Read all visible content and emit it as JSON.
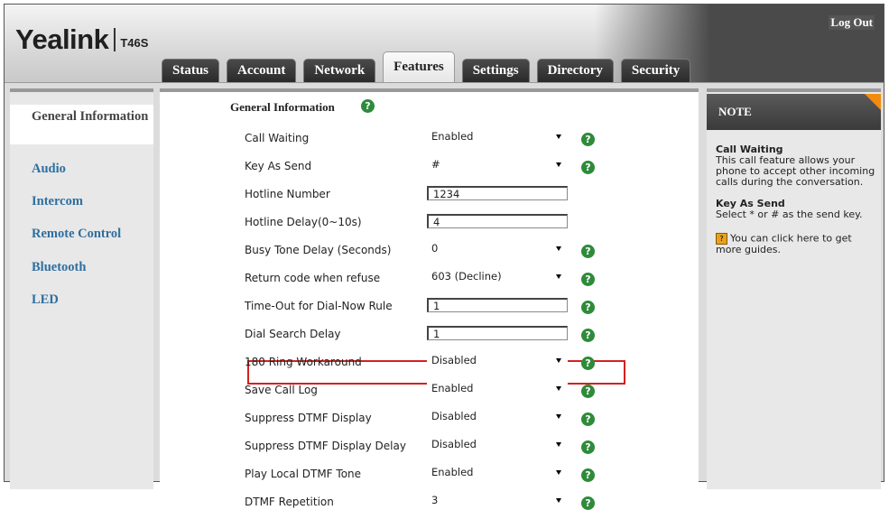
{
  "header": {
    "logo": "Yealink",
    "model": "T46S",
    "logout_label": "Log Out"
  },
  "tabs": [
    {
      "label": "Status"
    },
    {
      "label": "Account"
    },
    {
      "label": "Network"
    },
    {
      "label": "Features",
      "active": true
    },
    {
      "label": "Settings"
    },
    {
      "label": "Directory"
    },
    {
      "label": "Security"
    }
  ],
  "sidebar": {
    "items": [
      {
        "label": "General Information",
        "active": true
      },
      {
        "label": "Audio"
      },
      {
        "label": "Intercom"
      },
      {
        "label": "Remote Control"
      },
      {
        "label": "Bluetooth"
      },
      {
        "label": "LED"
      }
    ]
  },
  "main": {
    "section_title": "General Information",
    "rows": [
      {
        "label": "Call Waiting",
        "type": "select",
        "value": "Enabled",
        "help": true
      },
      {
        "label": "Key As Send",
        "type": "select",
        "value": "#",
        "help": true
      },
      {
        "label": "Hotline Number",
        "type": "text",
        "value": "1234",
        "help": false
      },
      {
        "label": "Hotline Delay(0~10s)",
        "type": "text",
        "value": "4",
        "help": false
      },
      {
        "label": "Busy Tone Delay (Seconds)",
        "type": "select",
        "value": "0",
        "help": true
      },
      {
        "label": "Return code when refuse",
        "type": "select",
        "value": "603 (Decline)",
        "help": true
      },
      {
        "label": "Time-Out for Dial-Now Rule",
        "type": "text",
        "value": "1",
        "help": true
      },
      {
        "label": "Dial Search Delay",
        "type": "text",
        "value": "1",
        "help": true
      },
      {
        "label": "180 Ring Workaround",
        "type": "select",
        "value": "Disabled",
        "help": true
      },
      {
        "label": "Save Call Log",
        "type": "select",
        "value": "Enabled",
        "help": true,
        "highlight": true
      },
      {
        "label": "Suppress DTMF Display",
        "type": "select",
        "value": "Disabled",
        "help": true
      },
      {
        "label": "Suppress DTMF Display Delay",
        "type": "select",
        "value": "Disabled",
        "help": true
      },
      {
        "label": "Play Local DTMF Tone",
        "type": "select",
        "value": "Enabled",
        "help": true
      },
      {
        "label": "DTMF Repetition",
        "type": "select",
        "value": "3",
        "help": true
      }
    ]
  },
  "note": {
    "title": "NOTE",
    "call_waiting_title": "Call Waiting",
    "call_waiting_text": "This call feature allows your phone to accept other incoming calls during the conversation.",
    "key_as_send_title": "Key As Send",
    "key_as_send_text": "Select * or # as the send key.",
    "guide_text": "You can click here to get more guides."
  },
  "colors": {
    "accent_link": "#2f6f9f",
    "help_icon": "#2e8b3a",
    "highlight_border": "#d32121",
    "note_corner": "#f28c0f"
  }
}
